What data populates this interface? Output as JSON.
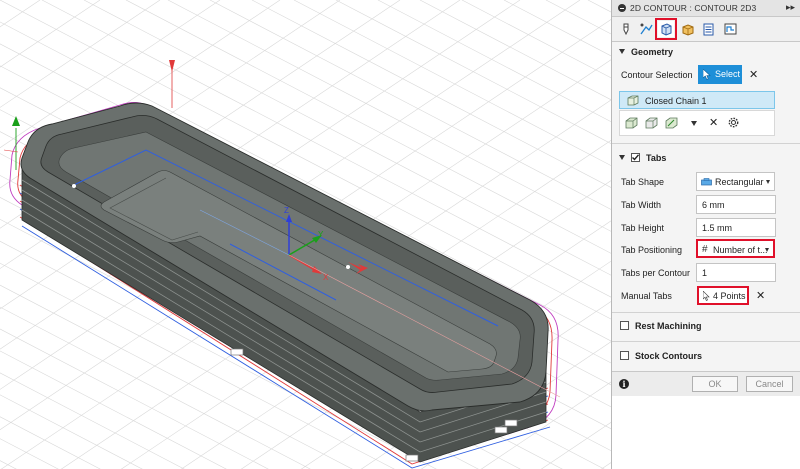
{
  "panel": {
    "title": "2D CONTOUR : CONTOUR 2D3",
    "expand_glyph": "▸▸",
    "tabs": [
      "tool-tab",
      "geometry-tab",
      "heights-tab",
      "passes-tab",
      "linking-tab",
      "simulation-tab"
    ],
    "active_tab": "geometry-tab",
    "accent_color": "#e0102a",
    "select_color": "#1e8fd8"
  },
  "geometry": {
    "heading": "Geometry",
    "contour_selection_label": "Contour Selection",
    "select_button": "Select",
    "chain_item": "Closed Chain 1"
  },
  "tabs_section": {
    "heading": "Tabs",
    "enabled": true,
    "tab_shape_label": "Tab Shape",
    "tab_shape_value": "Rectangular",
    "tab_width_label": "Tab Width",
    "tab_width_value": "6 mm",
    "tab_height_label": "Tab Height",
    "tab_height_value": "1.5 mm",
    "tab_positioning_label": "Tab Positioning",
    "tab_positioning_value": "Number of t...",
    "tabs_per_contour_label": "Tabs per Contour",
    "tabs_per_contour_value": "1",
    "manual_tabs_label": "Manual Tabs",
    "manual_tabs_value": "4 Points"
  },
  "rest_machining": {
    "label": "Rest Machining",
    "checked": false
  },
  "stock_contours": {
    "label": "Stock Contours",
    "checked": false
  },
  "footer": {
    "ok": "OK",
    "cancel": "Cancel",
    "info": "i"
  },
  "viewport": {
    "axes": {
      "x": "X",
      "y": "Y",
      "z": "Z"
    },
    "colors": {
      "part": "#5e6461",
      "toolpath_blue": "#2f5fe0",
      "toolpath_magenta": "#c03cc0",
      "toolpath_red": "#e03a3a"
    }
  }
}
